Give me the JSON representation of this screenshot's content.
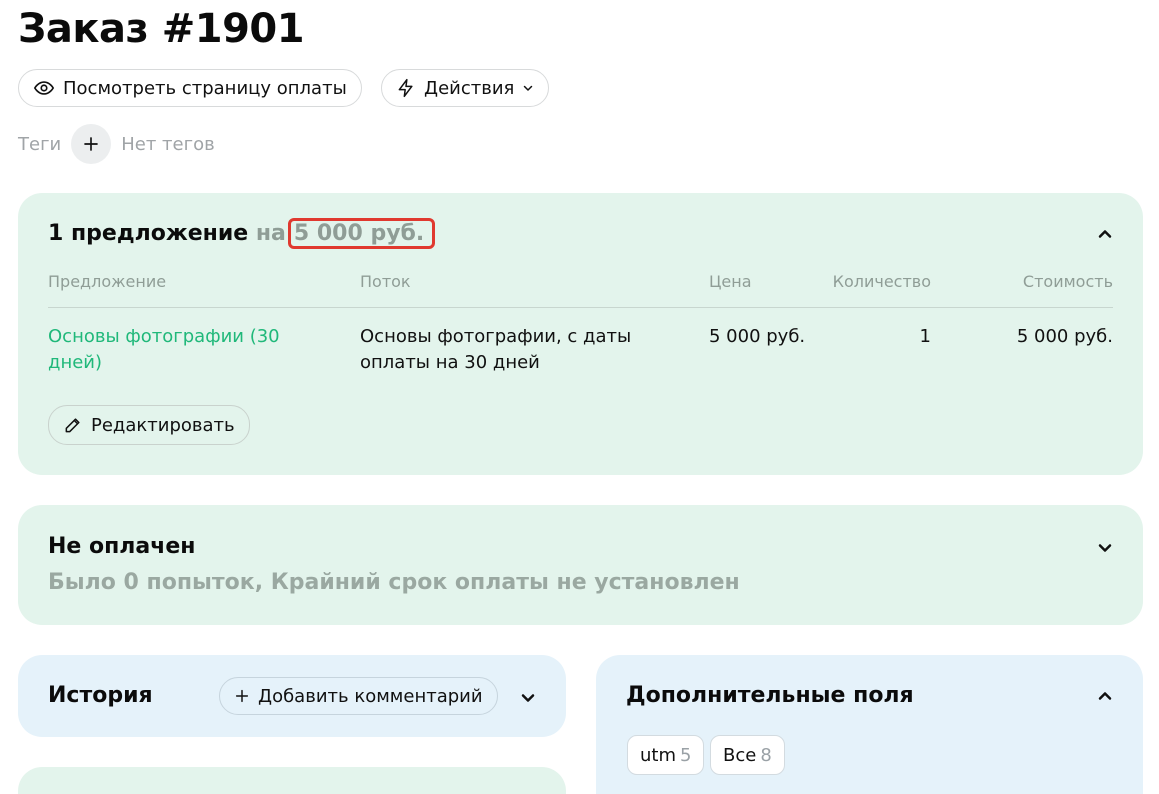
{
  "header": {
    "title": "Заказ #1901",
    "view_payment_label": "Посмотреть страницу оплаты",
    "actions_label": "Действия"
  },
  "tags": {
    "label": "Теги",
    "empty_text": "Нет тегов"
  },
  "offers": {
    "title": "1 предложение",
    "connector": "на",
    "total": "5 000 руб.",
    "columns": [
      "Предложение",
      "Поток",
      "Цена",
      "Количество",
      "Стоимость"
    ],
    "rows": [
      {
        "offer": "Основы фотографии (30 дней)",
        "stream": "Основы фотографии, с даты оплаты на 30 дней",
        "price": "5 000 руб.",
        "quantity": "1",
        "cost": "5 000 руб."
      }
    ],
    "edit_label": "Редактировать"
  },
  "payment": {
    "status": "Не оплачен",
    "details": "Было 0 попыток, Крайний срок оплаты не установлен"
  },
  "history": {
    "title": "История",
    "add_comment_label": "Добавить комментарий"
  },
  "extra_fields": {
    "title": "Дополнительные поля",
    "filters": [
      {
        "label": "utm",
        "count": "5"
      },
      {
        "label": "Все",
        "count": "8"
      }
    ]
  },
  "colors": {
    "accent_green": "#20b87a",
    "card_green": "#e3f4ec",
    "card_blue": "#e5f2fa",
    "highlight_red": "#e0392f"
  }
}
